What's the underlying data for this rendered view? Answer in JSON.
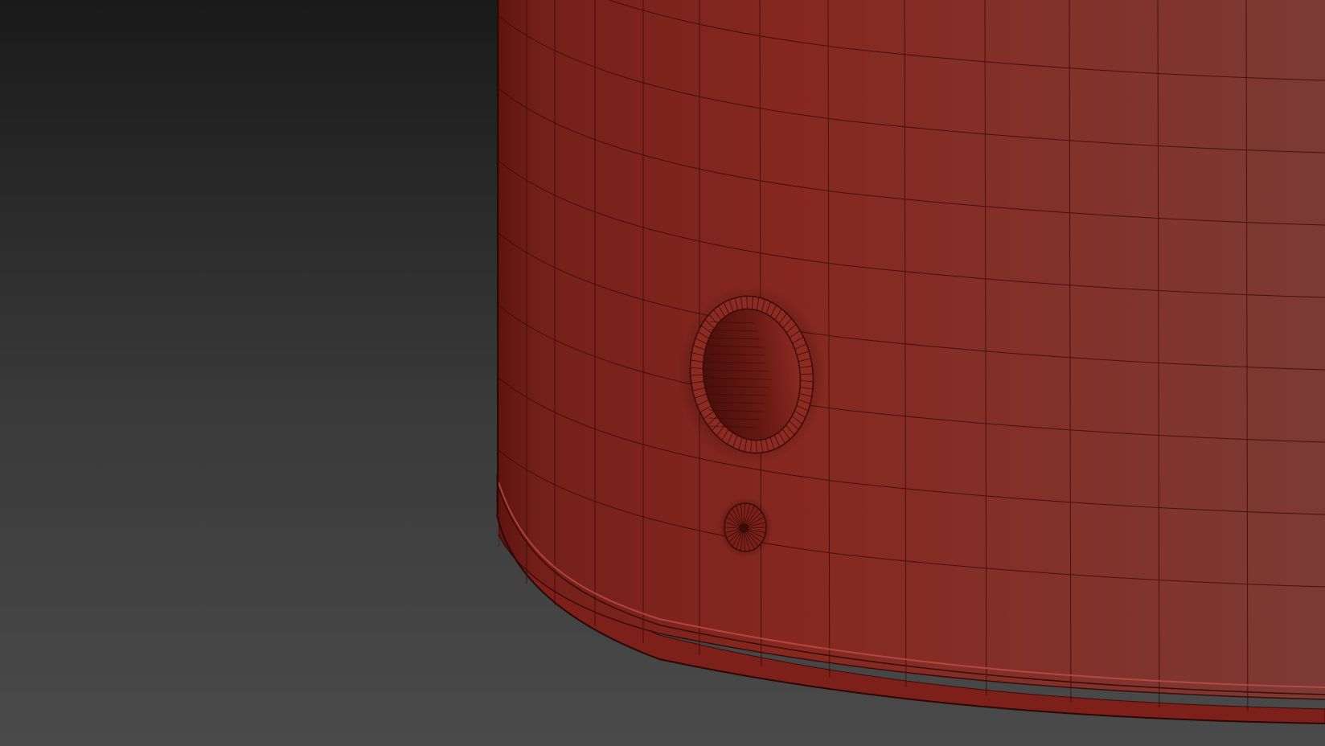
{
  "viewport": {
    "background_top": "#1a1a1a",
    "background_bottom": "#4a4a4a",
    "display_mode": "shaded-wireframe"
  },
  "model": {
    "shape": "cylinder",
    "color_left": "#6e1a14",
    "color_mid": "#85261f",
    "color_right": "#7e3a35",
    "wire_color": "#3a0c08",
    "features": [
      "port-ring",
      "small-knob",
      "base-rim"
    ]
  }
}
